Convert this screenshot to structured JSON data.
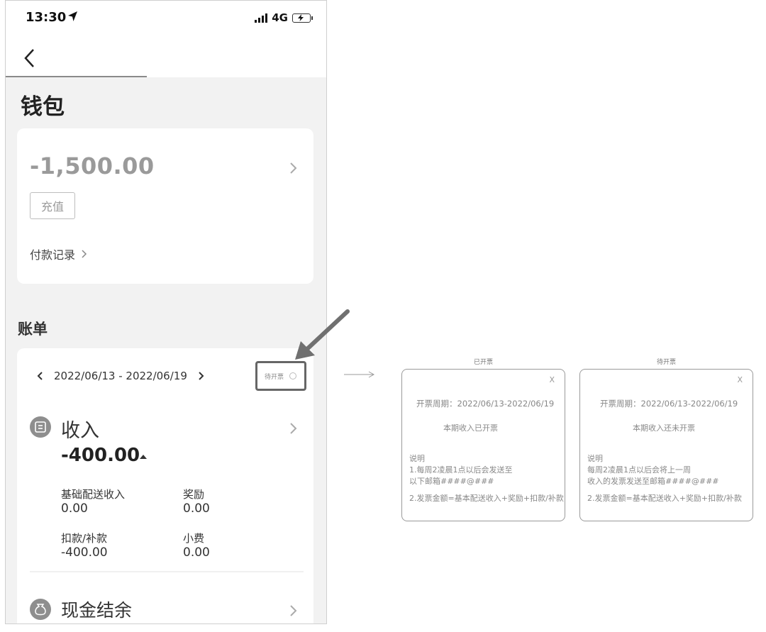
{
  "status_bar": {
    "time": "13:30",
    "network": "4G"
  },
  "page": {
    "title": "钱包"
  },
  "wallet": {
    "balance": "-1,500.00",
    "recharge_label": "充值",
    "payment_records_label": "付款记录"
  },
  "bill": {
    "section_title": "账单",
    "date_range": "2022/06/13 - 2022/06/19",
    "invoice_status": "待开票",
    "income": {
      "label": "收入",
      "total": "-400.00",
      "items": [
        {
          "label": "基础配送收入",
          "value": "0.00"
        },
        {
          "label": "奖励",
          "value": "0.00"
        },
        {
          "label": "扣款/补款",
          "value": "-400.00"
        },
        {
          "label": "小费",
          "value": "0.00"
        }
      ]
    },
    "cash_balance_label": "现金结余"
  },
  "popups": [
    {
      "caption": "已开票",
      "close": "X",
      "period": "开票周期：2022/06/13-2022/06/19",
      "status": "本期收入已开票",
      "note_title": "说明",
      "note_line1": "1.每周2凌晨1点以后会发送至",
      "note_line2": "以下邮箱####@###",
      "note_line3": "2.发票金额=基本配送收入+奖励+扣款/补款"
    },
    {
      "caption": "待开票",
      "close": "X",
      "period": "开票周期：2022/06/13-2022/06/19",
      "status": "本期收入还未开票",
      "note_title": "说明",
      "note_line1": "每周2凌晨1点以后会将上一周",
      "note_line2": "收入的发票发送至邮箱####@###",
      "note_line3": "2.发票金额=基本配送收入+奖励+扣款/补款"
    }
  ],
  "colors": {
    "page_background": "#f2f2f2",
    "card_background": "#ffffff",
    "muted_text": "#9a9a9a",
    "annotation_arrow": "#707070"
  }
}
